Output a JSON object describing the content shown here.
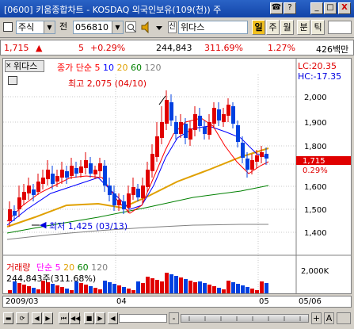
{
  "title": "[0600] 키움종합차트 - KOSDAQ 외국인보유(109(천)) 주",
  "title_buttons": [
    "☎",
    "?",
    "_",
    "□",
    "X"
  ],
  "toolbar": {
    "type_select": "주식",
    "period_select": "전",
    "code_value": "056810",
    "stock_name": "위다스",
    "tab_il": "일",
    "tab_ju": "주",
    "tab_wol": "월",
    "tab_bun": "분",
    "tab_tick": "틱"
  },
  "info": {
    "price": "1,715",
    "change": "5",
    "change_pct": "+0.29%",
    "volume": "244,843",
    "ratio1": "311.69%",
    "ratio2": "1.27%",
    "amount": "426백만"
  },
  "chart": {
    "stock_label": "위다스",
    "ma_title": "종가 단순",
    "ma_periods": [
      "5",
      "10",
      "20",
      "60",
      "120"
    ],
    "ma_colors": [
      "#ff0000",
      "#0000ff",
      "#e0a000",
      "#008000",
      "#808080"
    ],
    "lc_label": "LC:20.35",
    "hc_label": "HC:-17.35",
    "high_annotation": "최고 2,075 (04/10)",
    "low_annotation": "최저 1,425 (03/13)",
    "current_price_tag": "1,715",
    "current_pct_tag": "0.29%",
    "y_ticks": [
      "2,000",
      "1,900",
      "1,800",
      "1,700",
      "1,600",
      "1,500",
      "1,400"
    ],
    "volume_title": "거래량",
    "volume_ma_title": "단순",
    "volume_ma_periods": [
      "5",
      "20",
      "60",
      "120"
    ],
    "volume_info": "244,843주(311.68%)",
    "volume_tick": "2,000K"
  },
  "dates": {
    "d1": "2009/03",
    "d2": "04",
    "d3": "05",
    "d4": "05/06"
  },
  "nav": {
    "zoom_minus": "-",
    "zoom_plus": "+",
    "letter_a": "A"
  }
}
